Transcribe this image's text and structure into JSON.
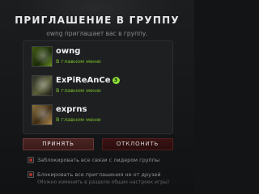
{
  "dialog": {
    "title": "ПРИГЛАШЕНИЕ В ГРУППУ",
    "subtitle": "owng приглашает вас в группу."
  },
  "members": [
    {
      "name": "owng",
      "status": "В главном меню",
      "avatar": "owng-avatar"
    },
    {
      "name": "ExPiReAnCe",
      "badge": "3",
      "status": "В главном меню",
      "avatar": "expireance-avatar"
    },
    {
      "name": "exprns",
      "status": "В главном меню",
      "avatar": "exprns-avatar"
    }
  ],
  "buttons": {
    "accept": "ПРИНЯТЬ",
    "decline": "ОТКЛОНИТЬ"
  },
  "options": [
    {
      "label": "Заблокировать все связи с лидером группы"
    },
    {
      "label": "Блокировать все приглашения не от друзей"
    }
  ],
  "hint": "(Можно изменить в разделе общих настроек игры)",
  "colors": {
    "status_green": "#7fbf2a",
    "accept_button": "#4a2422",
    "decline_button": "#3a1313"
  }
}
